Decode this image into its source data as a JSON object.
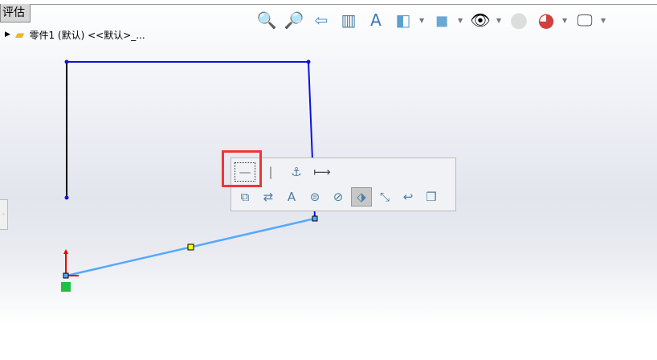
{
  "tab": {
    "label": "评估"
  },
  "tree": {
    "root_label": "零件1 (默认) <<默认>_..."
  },
  "toolbar": {
    "icons": [
      "zoom-to-fit-icon",
      "zoom-to-area-icon",
      "previous-view-icon",
      "section-view-icon",
      "dynamic-annotation-view-icon",
      "view-orientation-icon",
      "display-style-icon",
      "hide-show-items-icon",
      "edit-appearance-icon",
      "apply-scene-icon",
      "view-settings-icon"
    ]
  },
  "context_toolbar": {
    "row1": [
      "horizontal-relation-icon",
      "vertical-relation-icon",
      "fix-relation-icon",
      "smart-dimension-icon"
    ],
    "row2": [
      "select-other-icon",
      "mirror-icon",
      "note-icon",
      "equation-icon",
      "relation-icon",
      "convert-entities-icon",
      "offset-icon",
      "trim-icon",
      "3d-sketch-icon"
    ]
  },
  "colors": {
    "defined": "#1010e0",
    "selected": "#55a8ff",
    "highlight": "#f03535"
  }
}
